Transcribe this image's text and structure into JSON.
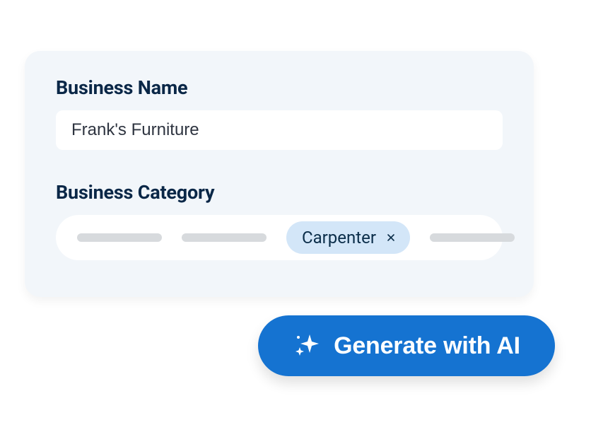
{
  "form": {
    "business_name": {
      "label": "Business Name",
      "value": "Frank's Furniture"
    },
    "business_category": {
      "label": "Business Category",
      "selected_tag": "Carpenter"
    }
  },
  "actions": {
    "generate_label": "Generate with AI"
  }
}
